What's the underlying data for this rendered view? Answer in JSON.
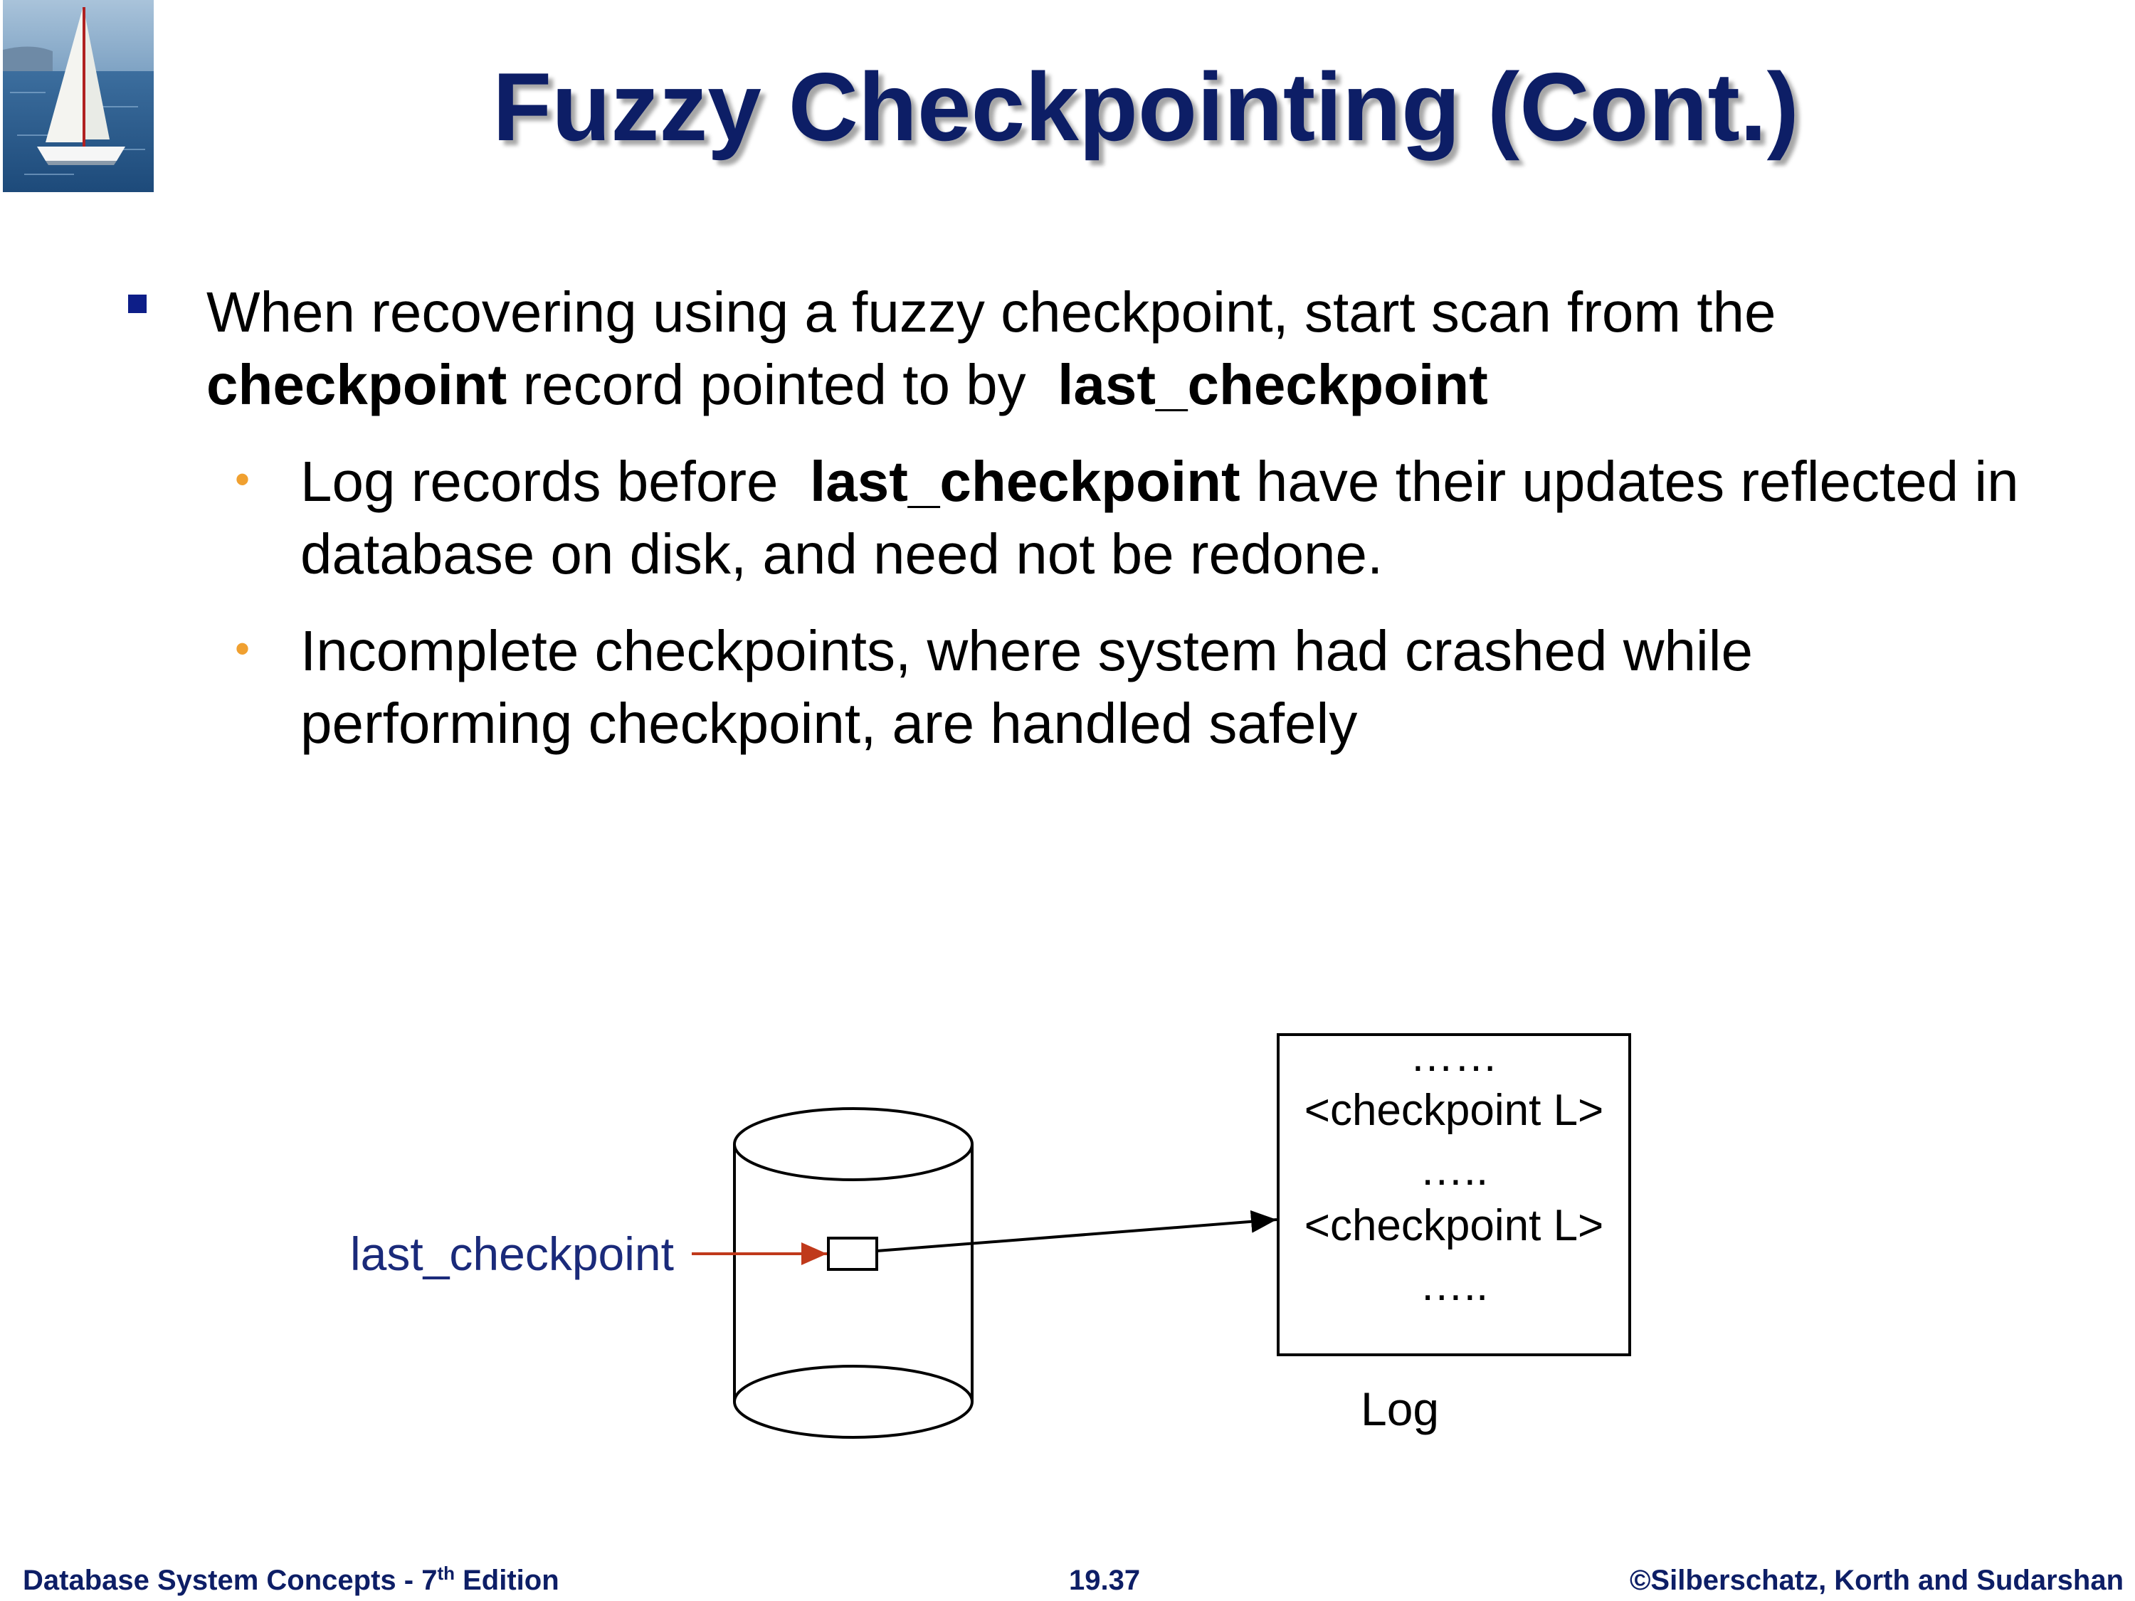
{
  "slide": {
    "title": "Fuzzy Checkpointing (Cont.)"
  },
  "bullets": {
    "main": {
      "part1": "When recovering using a fuzzy checkpoint, start scan from the",
      "bold1": "checkpoint",
      "part2": " record pointed to by  ",
      "bold2": "last_checkpoint"
    },
    "sub1": {
      "part1": "Log records before  ",
      "bold1": "last_checkpoint",
      "part2": " have their updates reflected in database on disk, and need not be redone."
    },
    "sub2": {
      "text": "Incomplete checkpoints, where system had crashed while performing checkpoint, are handled safely"
    },
    "sub_bullet_color": "#f0a030",
    "main_bullet_color": "#0d1e88"
  },
  "diagram": {
    "pointer_label": "last_checkpoint",
    "log_lines": [
      "……",
      "<checkpoint L>",
      "…..",
      "<checkpoint L>",
      "….."
    ],
    "log_caption": "Log",
    "pointer_arrow_color": "#c0391b"
  },
  "footer": {
    "left_main": "Database System Concepts - 7",
    "left_sup": "th",
    "left_end": " Edition",
    "page_number": "19.37",
    "copyright": "©Silberschatz, Korth and Sudarshan"
  }
}
